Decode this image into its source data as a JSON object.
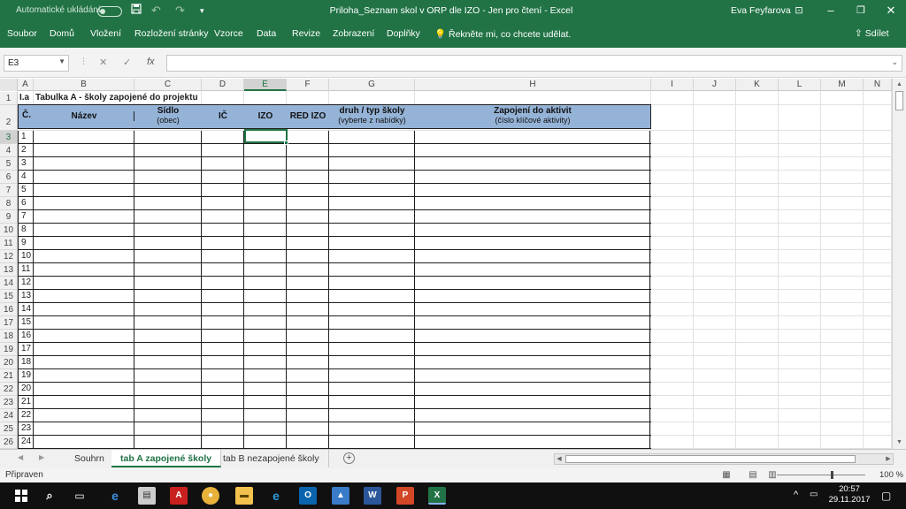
{
  "titlebar": {
    "autosave_label": "Automatické ukládání",
    "window_title": "Priloha_Seznam skol v ORP dle IZO  -  Jen pro čtení  -  Excel",
    "user_name": "Eva Feyfarova",
    "save_icon": "save-icon",
    "undo_icon": "undo-icon",
    "redo_icon": "redo-icon",
    "customize_icon": "customize-quick-access-icon",
    "ribbon_display_icon": "ribbon-display-options-icon",
    "restore_icon": "restore-icon",
    "close_icon": "close-icon",
    "accent_color": "#217346"
  },
  "ribbon": {
    "items": [
      "Soubor",
      "Domů",
      "Vložení",
      "Rozložení stránky",
      "Vzorce",
      "Data",
      "Revize",
      "Zobrazení",
      "Doplňky"
    ],
    "tell_me": "Řekněte mi, co chcete udělat.",
    "share": "Sdílet"
  },
  "formula_bar": {
    "name_box": "E3",
    "fx": "fx",
    "cancel_glyph": "✕",
    "enter_glyph": "✓",
    "formula": ""
  },
  "sheet": {
    "columns": [
      "A",
      "B",
      "C",
      "D",
      "E",
      "F",
      "G",
      "H",
      "I",
      "J",
      "K",
      "L",
      "M",
      "N"
    ],
    "selected_column": "E",
    "selected_row": "3",
    "row_headers": [
      "1",
      "2",
      "3",
      "4",
      "5",
      "6",
      "7",
      "8",
      "9",
      "10",
      "11",
      "12",
      "13",
      "14",
      "15",
      "16",
      "17",
      "18",
      "19",
      "20",
      "21",
      "22",
      "23",
      "24",
      "25",
      "26"
    ],
    "cell_A1": "I.a",
    "cell_B1": "Tabulka A - školy zapojené do projektu",
    "header": {
      "cislo": "Č.",
      "nazev": "Název",
      "sidlo": "Sídlo",
      "sidlo_sub": "(obec)",
      "ic": "IČ",
      "izo": "IZO",
      "red_izo": "RED IZO",
      "druh": "druh / typ školy",
      "druh_sub": "(vyberte z nabídky)",
      "zapojeni": "Zapojení do aktivit",
      "zapojeni_sub": "(číslo klíčové aktivity)"
    },
    "numbers": [
      "1",
      "2",
      "3",
      "4",
      "5",
      "6",
      "7",
      "8",
      "9",
      "10",
      "11",
      "12",
      "13",
      "14",
      "15",
      "16",
      "17",
      "18",
      "19",
      "20",
      "21",
      "22",
      "23",
      "24"
    ],
    "header_fill": "#95b3d7"
  },
  "tabs": {
    "items": [
      "Souhrn",
      "tab A zapojené školy",
      "tab B nezapojené školy"
    ],
    "active": "tab A zapojené školy",
    "add_icon": "add-sheet-icon"
  },
  "status": {
    "text": "Připraven",
    "zoom": "100 %"
  },
  "taskbar": {
    "time": "20:57",
    "date": "29.11.2017",
    "apps": [
      "start-icon",
      "search-icon",
      "task-view-icon",
      "edge-icon",
      "store-icon",
      "acrobat-icon",
      "chrome-icon",
      "file-explorer-icon",
      "ie-icon",
      "outlook-icon",
      "uploader-icon",
      "word-icon",
      "powerpoint-icon",
      "excel-icon"
    ]
  }
}
